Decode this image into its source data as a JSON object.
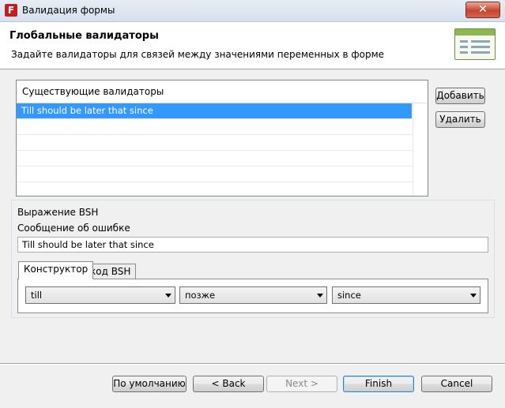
{
  "window": {
    "title": "Валидация формы",
    "app_icon": "F",
    "close_glyph": "✕"
  },
  "banner": {
    "title": "Глобальные валидаторы",
    "subtitle": "Задайте валидаторы для связей между значениями переменных в форме",
    "icon": "form-grid-icon"
  },
  "validators": {
    "header": "Существующие валидаторы",
    "items": [
      "Till should be later that since"
    ],
    "selected_index": 0
  },
  "side_buttons": {
    "add": "Добавить",
    "remove": "Удалить"
  },
  "bsh": {
    "expression_label": "Выражение BSH",
    "error_label": "Сообщение об ошибке",
    "error_value": "Till should be later that since",
    "tabs": [
      {
        "label": "Конструктор",
        "active": true
      },
      {
        "label": "код BSH",
        "active": false
      }
    ],
    "selects": [
      {
        "value": "till"
      },
      {
        "value": "позже"
      },
      {
        "value": "since"
      }
    ]
  },
  "footer": {
    "defaults": "По умолчанию",
    "back": "< Back",
    "next": "Next >",
    "finish": "Finish",
    "cancel": "Cancel"
  }
}
